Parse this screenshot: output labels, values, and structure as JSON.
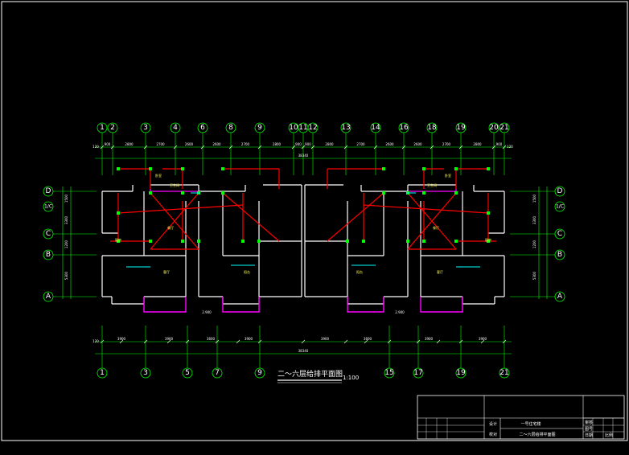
{
  "drawing": {
    "title": "二～六层给排平面图",
    "scale": "1:100",
    "top_axes": [
      "1",
      "2",
      "3",
      "4",
      "6",
      "8",
      "9",
      "10",
      "11",
      "12",
      "13",
      "14",
      "16",
      "18",
      "19",
      "20",
      "21"
    ],
    "bottom_axes": [
      "1",
      "3",
      "5",
      "7",
      "9",
      "15",
      "17",
      "19",
      "21"
    ],
    "left_axes": [
      "D",
      "C",
      "B",
      "A"
    ],
    "left_axis_minor": "1/C",
    "right_axes": [
      "D",
      "C",
      "B",
      "A"
    ],
    "right_axis_minor": "1/C",
    "top_dims": [
      "900",
      "2800",
      "2700",
      "2600",
      "2600",
      "2700",
      "2800",
      "900",
      "900",
      "2800",
      "2700",
      "2600",
      "2600",
      "2700",
      "2800",
      "900"
    ],
    "top_total": "38340",
    "bottom_dims": [
      "3900",
      "3900",
      "3600",
      "3900",
      "3900",
      "3600",
      "3900",
      "3900"
    ],
    "bottom_total": "38340",
    "side_dims_left": [
      "1500",
      "3300",
      "1200",
      "5300"
    ],
    "side_dims_right": [
      "1500",
      "3300",
      "1200",
      "5300"
    ],
    "edge_dim": "120",
    "room_labels": [
      "卧室",
      "卫生间",
      "厨房",
      "客厅",
      "阳台",
      "餐厅"
    ],
    "stair_label": "2.900"
  },
  "title_block": {
    "project": "一号住宅楼",
    "sheet": "二～六层给排平面图",
    "labels": [
      "设计",
      "校对",
      "审核",
      "图号",
      "日期",
      "比例"
    ]
  },
  "colors": {
    "background": "#000000",
    "wall": "#ffffff",
    "axis": "#00ff00",
    "pipe": "#ff0000",
    "balcony": "#ff00ff",
    "fixture": "#00ffff",
    "text": "#ffff55"
  }
}
